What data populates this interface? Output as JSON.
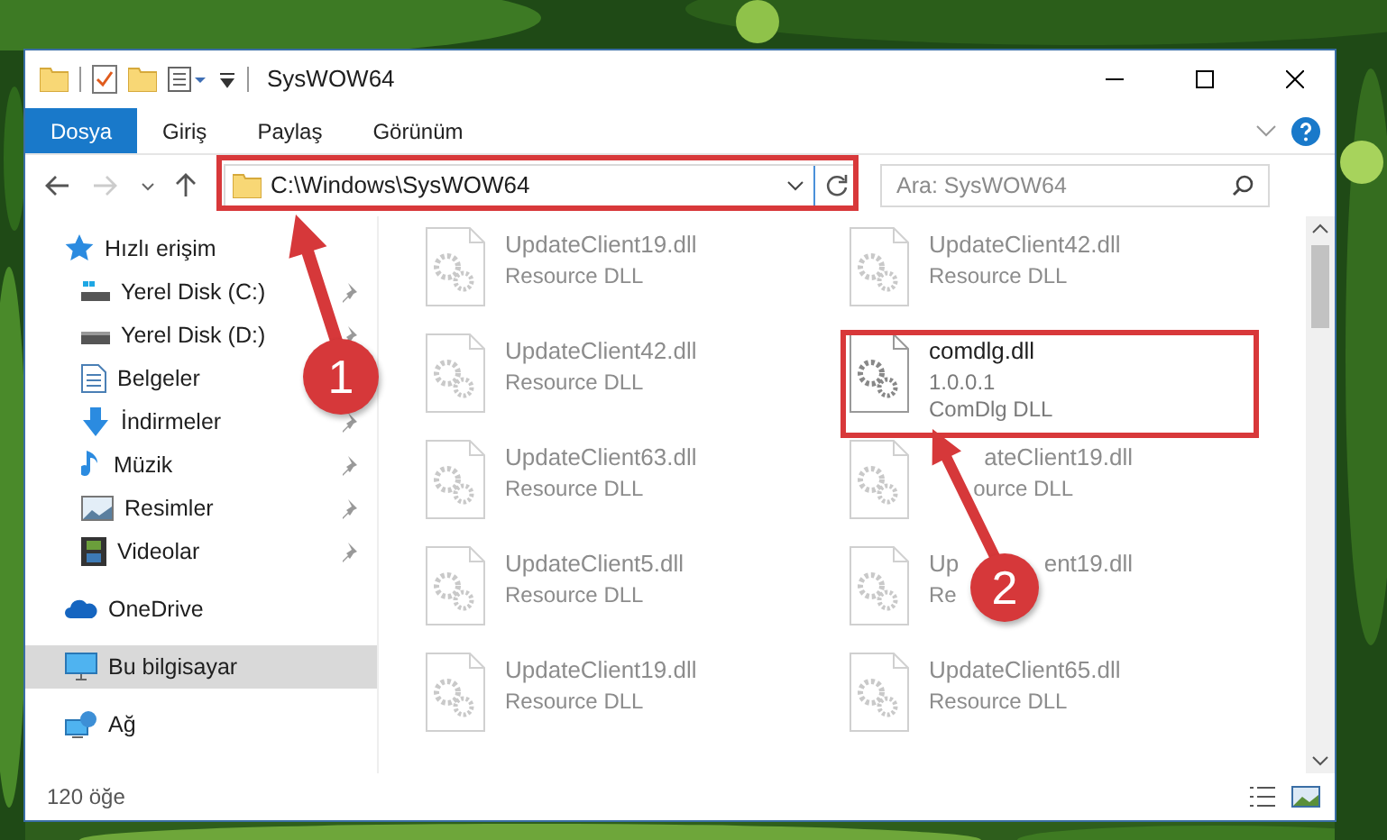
{
  "window": {
    "title": "SysWOW64"
  },
  "ribbon_tabs": [
    {
      "label": "Dosya",
      "selected": true
    },
    {
      "label": "Giriş",
      "selected": false
    },
    {
      "label": "Paylaş",
      "selected": false
    },
    {
      "label": "Görünüm",
      "selected": false
    }
  ],
  "address": {
    "path": "C:\\Windows\\SysWOW64"
  },
  "search": {
    "placeholder": "Ara: SysWOW64"
  },
  "sidebar": {
    "items": [
      {
        "label": "Hızlı erişim",
        "selected": false,
        "children": [
          {
            "label": "Yerel Disk (C:)",
            "pinned": true
          },
          {
            "label": "Yerel Disk (D:)",
            "pinned": true
          },
          {
            "label": "Belgeler"
          },
          {
            "label": "İndirmeler",
            "pinned": true
          },
          {
            "label": "Müzik",
            "pinned": true
          },
          {
            "label": "Resimler",
            "pinned": true
          },
          {
            "label": "Videolar",
            "pinned": true
          }
        ]
      },
      {
        "label": "OneDrive",
        "selected": false
      },
      {
        "label": "Bu bilgisayar",
        "selected": true
      },
      {
        "label": "Ağ",
        "selected": false
      }
    ]
  },
  "files": [
    {
      "name": [
        "UpdateClient19.dll"
      ],
      "lines": [
        [
          "Resource DLL"
        ]
      ],
      "blurred": true
    },
    {
      "name": [
        "UpdateClient42.dll"
      ],
      "lines": [
        [
          "Resource DLL"
        ]
      ],
      "blurred": true
    },
    {
      "name": [
        "UpdateClient42.dll"
      ],
      "lines": [
        [
          "Resource DLL"
        ]
      ],
      "blurred": true
    },
    {
      "name": [
        "comdlg.dll"
      ],
      "lines": [
        [
          "1.0.0.1"
        ],
        [
          "ComDlg DLL"
        ]
      ],
      "blurred": false
    },
    {
      "name": [
        "UpdateClient63.dll"
      ],
      "lines": [
        [
          "Resource DLL"
        ]
      ],
      "blurred": true
    },
    {
      "name": [
        "ateClient19.dll"
      ],
      "lines": [
        [
          "ource DLL"
        ]
      ],
      "blurred": true,
      "lead_hidden": true
    },
    {
      "name": [
        "UpdateClient5.dll"
      ],
      "lines": [
        [
          "Resource DLL"
        ]
      ],
      "blurred": true
    },
    {
      "name": [
        "Up",
        "ent19.dll"
      ],
      "lines": [
        [
          "Re"
        ]
      ],
      "blurred": true
    },
    {
      "name": [
        "UpdateClient19.dll"
      ],
      "lines": [
        [
          "Resource DLL"
        ]
      ],
      "blurred": true
    },
    {
      "name": [
        "UpdateClient65.dll"
      ],
      "lines": [
        [
          "Resource DLL"
        ]
      ],
      "blurred": true
    }
  ],
  "status_bar": {
    "count": "120 öğe"
  },
  "annotations": [
    {
      "number": "1"
    },
    {
      "number": "2"
    }
  ]
}
